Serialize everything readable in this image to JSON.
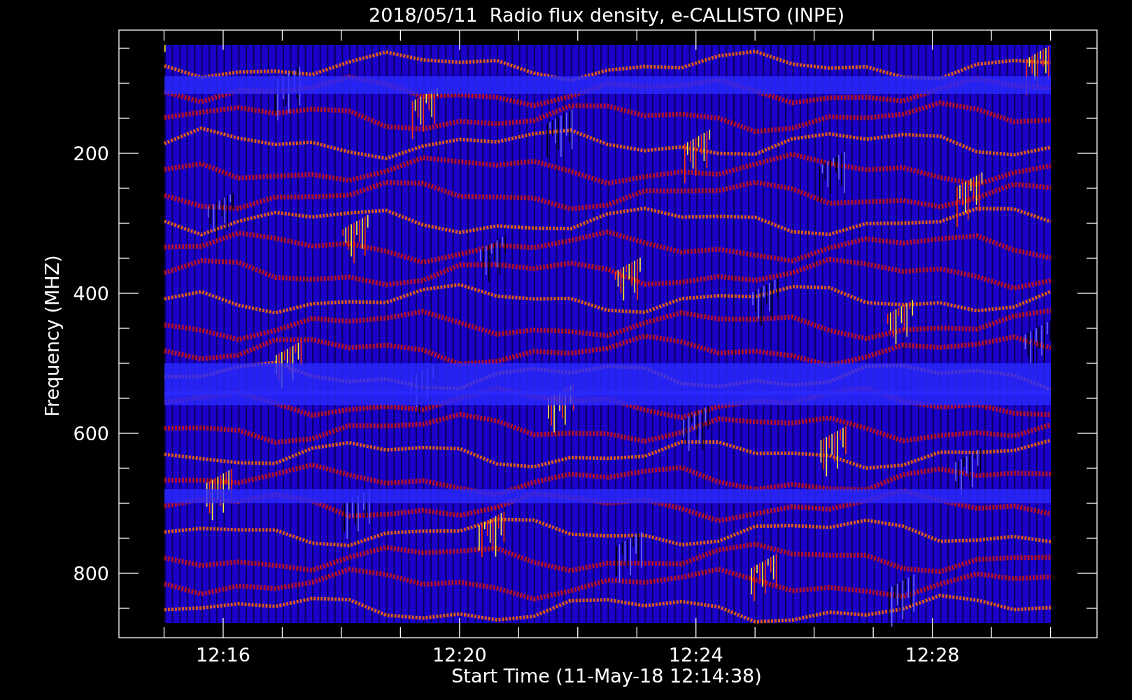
{
  "title": "2018/05/11  Radio flux density, e-CALLISTO (INPE)",
  "y_axis": {
    "label": "Frequency (MHZ)",
    "ticks": [
      "200",
      "400",
      "600",
      "800"
    ]
  },
  "x_axis": {
    "label": "Start Time (11-May-18 12:14:38)",
    "ticks": [
      "12:16",
      "12:20",
      "12:24",
      "12:28"
    ]
  }
}
